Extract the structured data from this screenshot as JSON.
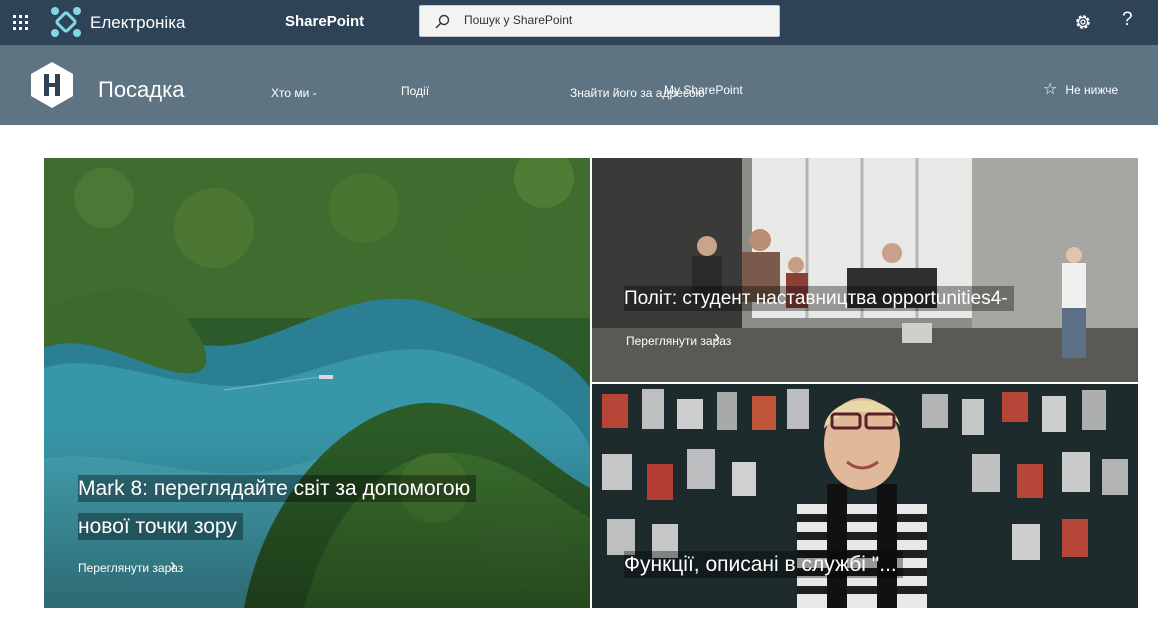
{
  "suite": {
    "app_name": "Електроніка",
    "product": "SharePoint",
    "search_label": "Пошук у SharePoint"
  },
  "site": {
    "title": "Посадка",
    "nav": [
      {
        "label": "Хто ми -"
      },
      {
        "label": "Події"
      },
      {
        "label": "Знайти його за адресою"
      },
      {
        "label": "My SharePoint"
      }
    ],
    "follow_label": "Не нижче"
  },
  "hero": {
    "tiles": [
      {
        "title_line1": "Mark 8: переглядайте світ за допомогою",
        "title_line2": "нової точки зору",
        "cta": "Переглянути зараз"
      },
      {
        "title": "Політ: студент наставництва opportunities4-",
        "cta": "Переглянути зараз"
      },
      {
        "title": "Функції, описані в службі \"..."
      }
    ]
  },
  "colors": {
    "suite_bar": "#2f4357",
    "site_header": "#5f7483"
  },
  "icons": [
    "waffle-icon",
    "brand-logo-icon",
    "search-icon",
    "settings-icon",
    "help-icon",
    "star-icon",
    "arrow-right-icon"
  ]
}
